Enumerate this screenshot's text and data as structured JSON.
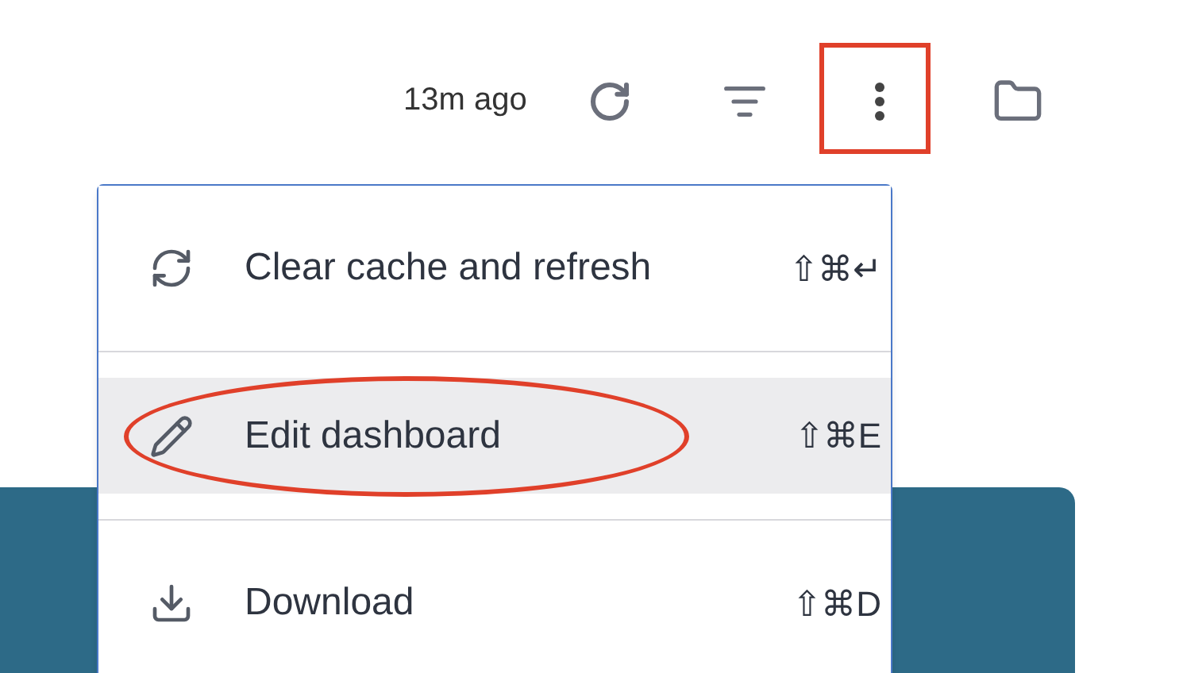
{
  "toolbar": {
    "updated": "13m ago"
  },
  "menu": {
    "items": [
      {
        "label": "Clear cache and refresh",
        "shortcut": "⇧⌘↵",
        "selected": false
      },
      {
        "label": "Edit dashboard",
        "shortcut": "⇧⌘E",
        "selected": true
      },
      {
        "label": "Download",
        "shortcut": "⇧⌘D",
        "selected": false
      }
    ]
  }
}
